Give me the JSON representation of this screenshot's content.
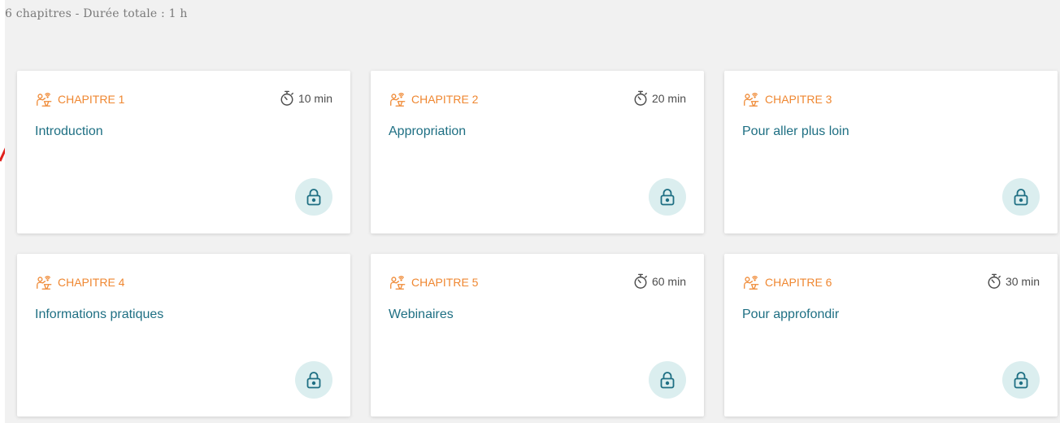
{
  "summary": "6 chapitres - Durée totale : 1 h",
  "colors": {
    "chapter_accent": "#ef8731",
    "title_link": "#1e6f83",
    "lock_bg": "#dbeeef",
    "background": "#f1f1f1"
  },
  "chapters": [
    {
      "label": "CHAPITRE 1",
      "title": "Introduction",
      "duration": "10 min",
      "icon": "presentation-icon",
      "status_icon": "lock-icon"
    },
    {
      "label": "CHAPITRE 2",
      "title": "Appropriation",
      "duration": "20 min",
      "icon": "presentation-icon",
      "status_icon": "lock-icon"
    },
    {
      "label": "CHAPITRE 3",
      "title": "Pour aller plus loin",
      "duration": "",
      "icon": "presentation-icon",
      "status_icon": "lock-icon"
    },
    {
      "label": "CHAPITRE 4",
      "title": "Informations pratiques",
      "duration": "",
      "icon": "presentation-icon",
      "status_icon": "lock-icon"
    },
    {
      "label": "CHAPITRE 5",
      "title": "Webinaires",
      "duration": "60 min",
      "icon": "presentation-icon",
      "status_icon": "lock-icon"
    },
    {
      "label": "CHAPITRE 6",
      "title": "Pour approfondir",
      "duration": "30 min",
      "icon": "presentation-icon",
      "status_icon": "lock-icon"
    }
  ]
}
